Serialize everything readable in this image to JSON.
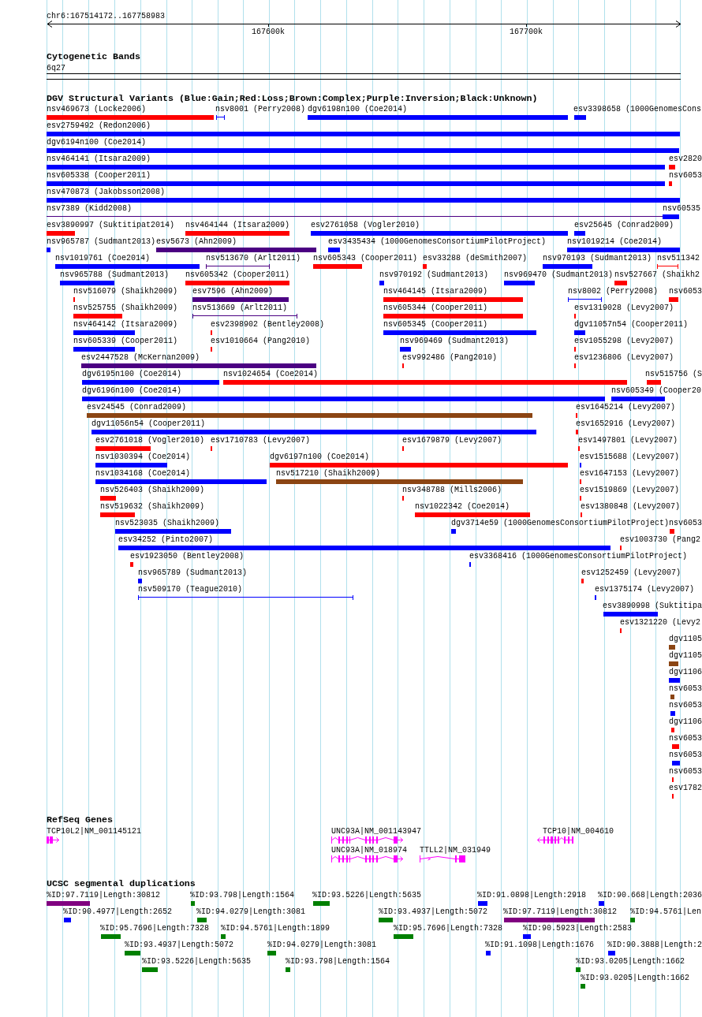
{
  "position": "chr6:167514172..167758983",
  "ruler": {
    "ticks": [
      "167600k",
      "167700k"
    ]
  },
  "cytogenetic_bands": {
    "title": "Cytogenetic Bands",
    "bands": [
      {
        "name": "6q27"
      }
    ]
  },
  "dgv_variants": {
    "title": "DGV Structural Variants (Blue:Gain;Red:Loss;Brown:Complex;Purple:Inversion;Black:Unknown)",
    "features": [
      {
        "label": "nsv469673 (Locke2006)",
        "kind": "block",
        "color": "#ff0000"
      },
      {
        "label": "nsv8001 (Perry2008)",
        "kind": "bracket",
        "color": "#0000ff"
      },
      {
        "label": "dgv6198n100 (Coe2014)",
        "kind": "block",
        "color": "#0000ff"
      },
      {
        "label": "esv3398658 (1000GenomesCons",
        "kind": "block",
        "color": "#0000ff"
      },
      {
        "label": "esv2759492 (Redon2006)",
        "kind": "block",
        "color": "#0000ff"
      },
      {
        "label": "dgv6194n100 (Coe2014)",
        "kind": "block",
        "color": "#0000ff"
      },
      {
        "label": "nsv464141 (Itsara2009)",
        "kind": "block",
        "color": "#0000ff"
      },
      {
        "label": "esv2820",
        "kind": "block",
        "color": "#ff0000"
      },
      {
        "label": "nsv605338 (Cooper2011)",
        "kind": "block",
        "color": "#0000ff"
      },
      {
        "label": "nsv6053",
        "kind": "block",
        "color": "#ff0000"
      },
      {
        "label": "nsv470873 (Jakobsson2008)",
        "kind": "block",
        "color": "#0000ff"
      },
      {
        "label": "nsv7389 (Kidd2008)",
        "kind": "line",
        "color": "#4b0082"
      },
      {
        "label": "nsv60535",
        "kind": "block",
        "color": "#0000ff"
      },
      {
        "label": "esv3890997 (Suktitipat2014)",
        "kind": "block",
        "color": "#ff0000"
      },
      {
        "label": "nsv464144 (Itsara2009)",
        "kind": "block",
        "color": "#ff0000"
      },
      {
        "label": "esv2761058 (Vogler2010)",
        "kind": "block",
        "color": "#0000ff"
      },
      {
        "label": "esv25645 (Conrad2009)",
        "kind": "block",
        "color": "#0000ff"
      },
      {
        "label": "nsv965787 (Sudmant2013)",
        "kind": "block",
        "color": "#0000ff"
      },
      {
        "label": "esv5673 (Ahn2009)",
        "kind": "block",
        "color": "#4b0082"
      },
      {
        "label": "esv3435434 (1000GenomesConsortiumPilotProject)",
        "kind": "block",
        "color": "#0000ff"
      },
      {
        "label": "nsv1019214 (Coe2014)",
        "kind": "block",
        "color": "#0000ff"
      },
      {
        "label": "nsv1019761 (Coe2014)",
        "kind": "block",
        "color": "#0000ff"
      },
      {
        "label": "nsv513670 (Arlt2011)",
        "kind": "bracket",
        "color": "#4b0082"
      },
      {
        "label": "nsv605343 (Cooper2011)",
        "kind": "block",
        "color": "#ff0000"
      },
      {
        "label": "esv33288 (deSmith2007)",
        "kind": "block",
        "color": "#ff0000"
      },
      {
        "label": "nsv970193 (Sudmant2013)",
        "kind": "block",
        "color": "#0000ff"
      },
      {
        "label": "nsv511342",
        "kind": "bracket",
        "color": "#ff0000"
      },
      {
        "label": "nsv965788 (Sudmant2013)",
        "kind": "block",
        "color": "#0000ff"
      },
      {
        "label": "nsv605342 (Cooper2011)",
        "kind": "block",
        "color": "#ff0000"
      },
      {
        "label": "nsv970192 (Sudmant2013)",
        "kind": "block",
        "color": "#0000ff"
      },
      {
        "label": "nsv969470 (Sudmant2013)",
        "kind": "block",
        "color": "#0000ff"
      },
      {
        "label": "nsv527667 (Shaikh2",
        "kind": "block",
        "color": "#ff0000"
      },
      {
        "label": "nsv516079 (Shaikh2009)",
        "kind": "block",
        "color": "#ff0000"
      },
      {
        "label": "esv7596 (Ahn2009)",
        "kind": "block",
        "color": "#4b0082"
      },
      {
        "label": "nsv464145 (Itsara2009)",
        "kind": "block",
        "color": "#ff0000"
      },
      {
        "label": "nsv8002 (Perry2008)",
        "kind": "bracket",
        "color": "#0000ff"
      },
      {
        "label": "nsv6053",
        "kind": "block",
        "color": "#ff0000"
      },
      {
        "label": "nsv525755 (Shaikh2009)",
        "kind": "block",
        "color": "#ff0000"
      },
      {
        "label": "nsv513669 (Arlt2011)",
        "kind": "bracket",
        "color": "#4b0082"
      },
      {
        "label": "nsv605344 (Cooper2011)",
        "kind": "block",
        "color": "#ff0000"
      },
      {
        "label": "esv1319028 (Levy2007)",
        "kind": "block",
        "color": "#ff0000"
      },
      {
        "label": "nsv464142 (Itsara2009)",
        "kind": "block",
        "color": "#0000ff"
      },
      {
        "label": "esv2398902 (Bentley2008)",
        "kind": "block",
        "color": "#ff0000"
      },
      {
        "label": "nsv605345 (Cooper2011)",
        "kind": "block",
        "color": "#0000ff"
      },
      {
        "label": "dgv11057n54 (Cooper2011)",
        "kind": "block",
        "color": "#0000ff"
      },
      {
        "label": "nsv605339 (Cooper2011)",
        "kind": "block",
        "color": "#0000ff"
      },
      {
        "label": "esv1010664 (Pang2010)",
        "kind": "block",
        "color": "#ff0000"
      },
      {
        "label": "nsv969469 (Sudmant2013)",
        "kind": "block",
        "color": "#0000ff"
      },
      {
        "label": "esv1055298 (Levy2007)",
        "kind": "block",
        "color": "#ff0000"
      },
      {
        "label": "esv2447528 (McKernan2009)",
        "kind": "block",
        "color": "#4b0082"
      },
      {
        "label": "esv992486 (Pang2010)",
        "kind": "block",
        "color": "#ff0000"
      },
      {
        "label": "esv1236806 (Levy2007)",
        "kind": "block",
        "color": "#ff0000"
      },
      {
        "label": "dgv6195n100 (Coe2014)",
        "kind": "block",
        "color": "#0000ff"
      },
      {
        "label": "nsv1024654 (Coe2014)",
        "kind": "block",
        "color": "#ff0000"
      },
      {
        "label": "nsv515756 (S",
        "kind": "block",
        "color": "#ff0000"
      },
      {
        "label": "dgv6196n100 (Coe2014)",
        "kind": "block",
        "color": "#0000ff"
      },
      {
        "label": "nsv605349 (Cooper20",
        "kind": "block",
        "color": "#0000ff"
      },
      {
        "label": "esv24545 (Conrad2009)",
        "kind": "block",
        "color": "#8b4513"
      },
      {
        "label": "esv1645214 (Levy2007)",
        "kind": "block",
        "color": "#ff0000"
      },
      {
        "label": "dgv11056n54 (Cooper2011)",
        "kind": "block",
        "color": "#0000ff"
      },
      {
        "label": "esv1652916 (Levy2007)",
        "kind": "block",
        "color": "#ff0000"
      },
      {
        "label": "esv2761018 (Vogler2010)",
        "kind": "block",
        "color": "#ff0000"
      },
      {
        "label": "esv1710783 (Levy2007)",
        "kind": "block",
        "color": "#ff0000"
      },
      {
        "label": "esv1679879 (Levy2007)",
        "kind": "block",
        "color": "#ff0000"
      },
      {
        "label": "esv1497801 (Levy2007)",
        "kind": "block",
        "color": "#ff0000"
      },
      {
        "label": "nsv1030394 (Coe2014)",
        "kind": "block",
        "color": "#0000ff"
      },
      {
        "label": "dgv6197n100 (Coe2014)",
        "kind": "block",
        "color": "#ff0000"
      },
      {
        "label": "esv1515688 (Levy2007)",
        "kind": "block",
        "color": "#0000ff"
      },
      {
        "label": "nsv1034168 (Coe2014)",
        "kind": "block",
        "color": "#0000ff"
      },
      {
        "label": "nsv517210 (Shaikh2009)",
        "kind": "block",
        "color": "#8b4513"
      },
      {
        "label": "esv1647153 (Levy2007)",
        "kind": "block",
        "color": "#ff0000"
      },
      {
        "label": "nsv526403 (Shaikh2009)",
        "kind": "block",
        "color": "#ff0000"
      },
      {
        "label": "nsv348788 (Mills2006)",
        "kind": "block",
        "color": "#ff0000"
      },
      {
        "label": "esv1519869 (Levy2007)",
        "kind": "block",
        "color": "#ff0000"
      },
      {
        "label": "nsv519632 (Shaikh2009)",
        "kind": "block",
        "color": "#ff0000"
      },
      {
        "label": "nsv1022342 (Coe2014)",
        "kind": "block",
        "color": "#ff0000"
      },
      {
        "label": "esv1380848 (Levy2007)",
        "kind": "block",
        "color": "#ff0000"
      },
      {
        "label": "nsv523035 (Shaikh2009)",
        "kind": "block",
        "color": "#0000ff"
      },
      {
        "label": "dgv3714e59 (1000GenomesConsortiumPilotProject)",
        "kind": "block",
        "color": "#0000ff"
      },
      {
        "label": "nsv6053",
        "kind": "block",
        "color": "#ff0000"
      },
      {
        "label": "esv34252 (Pinto2007)",
        "kind": "block",
        "color": "#0000ff"
      },
      {
        "label": "esv1003730 (Pang2",
        "kind": "block",
        "color": "#ff0000"
      },
      {
        "label": "esv1923050 (Bentley2008)",
        "kind": "block",
        "color": "#ff0000"
      },
      {
        "label": "esv3368416 (1000GenomesConsortiumPilotProject)",
        "kind": "block",
        "color": "#0000ff"
      },
      {
        "label": "nsv965789 (Sudmant2013)",
        "kind": "block",
        "color": "#0000ff"
      },
      {
        "label": "esv1252459 (Levy2007)",
        "kind": "block",
        "color": "#ff0000"
      },
      {
        "label": "nsv509170 (Teague2010)",
        "kind": "bracket",
        "color": "#0000ff"
      },
      {
        "label": "esv1375174 (Levy2007)",
        "kind": "block",
        "color": "#0000ff"
      },
      {
        "label": "esv3890998 (Suktitipa",
        "kind": "block",
        "color": "#0000ff"
      },
      {
        "label": "esv1321220 (Levy2",
        "kind": "block",
        "color": "#ff0000"
      },
      {
        "label": "dgv1105",
        "kind": "block",
        "color": "#8b4513"
      },
      {
        "label": "dgv1105",
        "kind": "block",
        "color": "#8b4513"
      },
      {
        "label": "dgv1106",
        "kind": "block",
        "color": "#0000ff"
      },
      {
        "label": "nsv6053",
        "kind": "block",
        "color": "#8b4513"
      },
      {
        "label": "nsv6053",
        "kind": "block",
        "color": "#0000ff"
      },
      {
        "label": "dgv1106",
        "kind": "block",
        "color": "#ff0000"
      },
      {
        "label": "nsv6053",
        "kind": "block",
        "color": "#ff0000"
      },
      {
        "label": "nsv6053",
        "kind": "block",
        "color": "#0000ff"
      },
      {
        "label": "nsv6053",
        "kind": "block",
        "color": "#ff0000"
      },
      {
        "label": "esv1782",
        "kind": "block",
        "color": "#ff0000"
      }
    ]
  },
  "refseq_genes": {
    "title": "RefSeq Genes",
    "genes": [
      {
        "label": "TCP10L2|NM_001145121",
        "reverse_strand": false
      },
      {
        "label": "UNC93A|NM_001143947",
        "reverse_strand": false
      },
      {
        "label": "TCP10|NM_004610",
        "reverse_strand": true
      },
      {
        "label": "UNC93A|NM_018974",
        "reverse_strand": false
      },
      {
        "label": "TTLL2|NM_031949",
        "reverse_strand": false
      }
    ]
  },
  "segmental_duplications": {
    "title": "UCSC segmental duplications",
    "features": [
      {
        "label": "%ID:97.7119|Length:30812",
        "color": "#800080"
      },
      {
        "label": "%ID:93.798|Length:1564",
        "color": "#008000"
      },
      {
        "label": "%ID:93.5226|Length:5635",
        "color": "#008000"
      },
      {
        "label": "%ID:91.0898|Length:2918",
        "color": "#0000ff"
      },
      {
        "label": "%ID:90.668|Length:2036",
        "color": "#0000ff"
      },
      {
        "label": "%ID:90.4977|Length:2652",
        "color": "#0000ff"
      },
      {
        "label": "%ID:94.0279|Length:3081",
        "color": "#008000"
      },
      {
        "label": "%ID:93.4937|Length:5072",
        "color": "#008000"
      },
      {
        "label": "%ID:97.7119|Length:30812",
        "color": "#800080"
      },
      {
        "label": "%ID:94.5761|Len",
        "color": "#008000"
      },
      {
        "label": "%ID:95.7696|Length:7328",
        "color": "#008000"
      },
      {
        "label": "%ID:94.5761|Length:1899",
        "color": "#008000"
      },
      {
        "label": "%ID:95.7696|Length:7328",
        "color": "#008000"
      },
      {
        "label": "%ID:90.5923|Length:2583",
        "color": "#0000ff"
      },
      {
        "label": "%ID:93.4937|Length:5072",
        "color": "#008000"
      },
      {
        "label": "%ID:94.0279|Length:3081",
        "color": "#008000"
      },
      {
        "label": "%ID:91.1098|Length:1676",
        "color": "#0000ff"
      },
      {
        "label": "%ID:90.3888|Length:2",
        "color": "#0000ff"
      },
      {
        "label": "%ID:93.5226|Length:5635",
        "color": "#008000"
      },
      {
        "label": "%ID:93.798|Length:1564",
        "color": "#008000"
      },
      {
        "label": "%ID:93.0205|Length:1662",
        "color": "#008000"
      },
      {
        "label": "%ID:93.0205|Length:1662",
        "color": "#008000"
      }
    ]
  }
}
